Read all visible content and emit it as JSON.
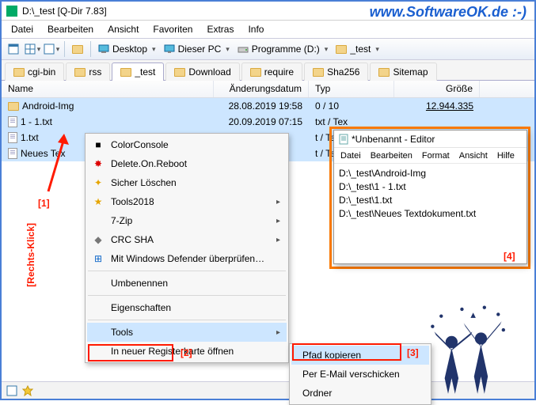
{
  "window": {
    "title": "D:\\_test  [Q-Dir 7.83]"
  },
  "watermark": "www.SoftwareOK.de :-)",
  "menu": {
    "items": [
      "Datei",
      "Bearbeiten",
      "Ansicht",
      "Favoriten",
      "Extras",
      "Info"
    ]
  },
  "toolbar": {
    "drops": [
      {
        "icon": "desktop-icon",
        "label": "Desktop"
      },
      {
        "icon": "thispc-icon",
        "label": "Dieser PC"
      },
      {
        "icon": "drive-icon",
        "label": "Programme (D:)"
      },
      {
        "icon": "folder-icon",
        "label": "_test"
      }
    ]
  },
  "tabs": [
    "cgi-bin",
    "rss",
    "_test",
    "Download",
    "require",
    "Sha256",
    "Sitemap"
  ],
  "active_tab": 2,
  "columns": {
    "name": "Name",
    "date": "Änderungsdatum",
    "type": "Typ",
    "size": "Größe"
  },
  "rows": [
    {
      "icon": "folder",
      "name": "Android-Img",
      "date": "28.08.2019 19:58",
      "type": "0 / 10",
      "size": "12.944.335",
      "sel": true
    },
    {
      "icon": "txt",
      "name": "1 - 1.txt",
      "date": "20.09.2019 07:15",
      "type": "txt / Tex",
      "size": "",
      "sel": true
    },
    {
      "icon": "txt",
      "name": "1.txt",
      "date": "",
      "type": "t / Tex",
      "size": "",
      "sel": true
    },
    {
      "icon": "txt",
      "name": "Neues Tex",
      "date": "",
      "type": "t / Tex",
      "size": "",
      "sel": true
    }
  ],
  "ctx1": {
    "items": [
      {
        "icon": "■",
        "iconColor": "#000",
        "label": "ColorConsole"
      },
      {
        "icon": "✸",
        "iconColor": "#d00",
        "label": "Delete.On.Reboot"
      },
      {
        "icon": "✦",
        "iconColor": "#e6a500",
        "label": "Sicher Löschen"
      },
      {
        "icon": "★",
        "iconColor": "#e6a500",
        "label": "Tools2018",
        "sub": true
      },
      {
        "label": "7-Zip",
        "sub": true
      },
      {
        "icon": "◆",
        "iconColor": "#777",
        "label": "CRC SHA",
        "sub": true
      },
      {
        "icon": "⊞",
        "iconColor": "#0a64c8",
        "label": "Mit Windows Defender überprüfen…"
      },
      {
        "sep": true
      },
      {
        "label": "Umbenennen"
      },
      {
        "sep": true
      },
      {
        "label": "Eigenschaften"
      },
      {
        "sep": true
      },
      {
        "label": "Tools",
        "sub": true,
        "hl": true
      },
      {
        "label": "In neuer Registerkarte öffnen"
      }
    ]
  },
  "ctx2": {
    "items": [
      {
        "label": "Pfad kopieren",
        "hl": true
      },
      {
        "label": "Per E-Mail verschicken"
      },
      {
        "label": "Ordner"
      }
    ]
  },
  "notepad": {
    "title": "*Unbenannt - Editor",
    "menu": [
      "Datei",
      "Bearbeiten",
      "Format",
      "Ansicht",
      "Hilfe"
    ],
    "lines": [
      "D:\\_test\\Android-Img",
      "D:\\_test\\1 - 1.txt",
      "D:\\_test\\1.txt",
      "D:\\_test\\Neues Textdokument.txt"
    ]
  },
  "ann": {
    "a1": "[1]",
    "a2": "[2]",
    "a3": "[3]",
    "a4": "[4]",
    "rc": "[Rechts-Klick]"
  }
}
